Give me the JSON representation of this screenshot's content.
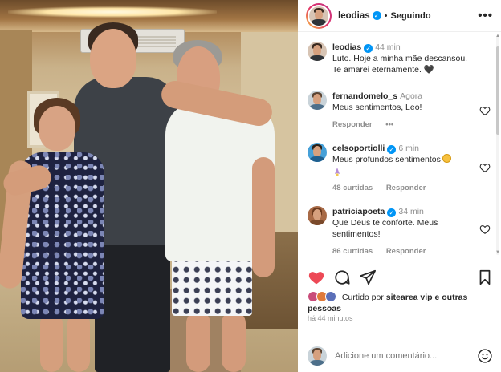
{
  "post": {
    "author": "leodias",
    "follow_status": "Seguindo",
    "separator": "•",
    "caption": {
      "username": "leodias",
      "time": "44 min",
      "text": "Luto. Hoje a minha mãe descansou. Te amarei eternamente. 🖤"
    },
    "liked_by": {
      "prefix": "Curtido por",
      "user": "sitearea vip",
      "suffix": "e outras pessoas"
    },
    "posted_ago": "há 44 minutos"
  },
  "comments": [
    {
      "username": "fernandomelo_s",
      "time": "Agora",
      "text": "Meus sentimentos, Leo!",
      "reply_label": "Responder",
      "more": "•••"
    },
    {
      "username": "celsoportiolli",
      "time": "6 min",
      "text": "Meus profundos sentimentos",
      "likes": "48 curtidas",
      "reply_label": "Responder"
    },
    {
      "username": "patriciapoeta",
      "time": "34 min",
      "text": "Que Deus te conforte. Meus sentimentos!",
      "likes": "86 curtidas",
      "reply_label": "Responder"
    }
  ],
  "comment_input": {
    "placeholder": "Adicione um comentário..."
  },
  "icons": {
    "verified": "verified-badge-icon",
    "more": "more-options-icon",
    "like": "heart-icon",
    "comment": "comment-icon",
    "share": "send-icon",
    "save": "bookmark-icon",
    "emoji": "emoji-icon"
  },
  "colors": {
    "liked_heart": "#ed4956",
    "verified": "#0095f6",
    "muted_text": "#8e8e8e"
  }
}
